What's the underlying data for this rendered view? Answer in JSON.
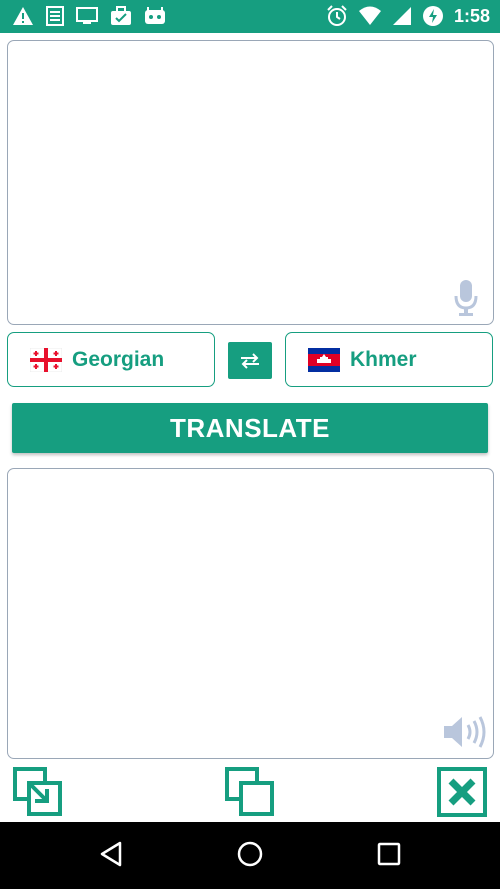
{
  "status_bar": {
    "time": "1:58",
    "left_icons": [
      "warning-icon",
      "notes-icon",
      "cast-icon",
      "briefcase-icon",
      "android-icon"
    ],
    "right_icons": [
      "alarm-icon",
      "wifi-icon",
      "signal-icon",
      "battery-charging-icon"
    ]
  },
  "translator": {
    "source_language": "Georgian",
    "target_language": "Khmer",
    "translate_label": "TRANSLATE",
    "input_text": "",
    "output_text": ""
  },
  "colors": {
    "accent": "#169E80",
    "border": "#9aa7b7",
    "icon_muted": "#b9c6dc"
  }
}
